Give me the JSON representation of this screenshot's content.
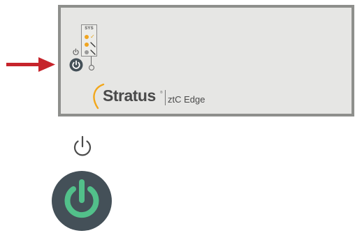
{
  "panel": {
    "sys_label": "SYS",
    "brand_name": "Stratus",
    "brand_mark": "®",
    "product_name": "ztC Edge"
  },
  "colors": {
    "arrow": "#c6242b",
    "led_orange": "#f0a520",
    "led_gray": "#9a9a9a",
    "swoosh": "#f2a71b",
    "power_button_dark": "#445058",
    "power_ring_green": "#52c08a",
    "device_face": "#e6e6e4",
    "device_border": "#8e8f8c"
  },
  "icons": {
    "pointer_arrow": "arrow-right-icon",
    "status_check": "checkmark-icon",
    "status_wrench": "wrench-icon",
    "standby": "power-symbol-icon",
    "power_button": "power-button-icon",
    "reset": "reset-pinhole-icon"
  }
}
